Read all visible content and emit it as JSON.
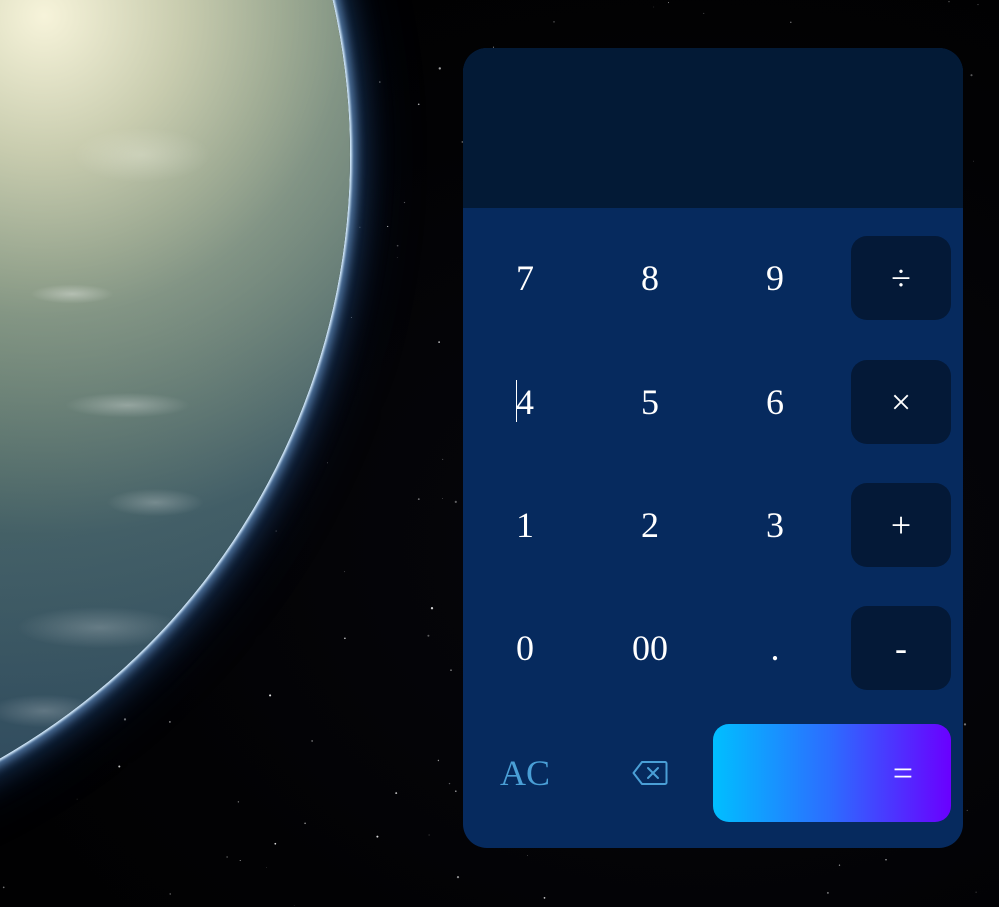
{
  "display": {
    "value": ""
  },
  "keys": {
    "row1": [
      "7",
      "8",
      "9",
      "÷"
    ],
    "row2": [
      "4",
      "5",
      "6",
      "×"
    ],
    "row3": [
      "1",
      "2",
      "3",
      "+"
    ],
    "row4": [
      "0",
      "00",
      ".",
      "-"
    ],
    "ac": "AC",
    "equals": "="
  },
  "colors": {
    "panel": "#062a5e",
    "display": "#031a36",
    "operator_key": "#041937",
    "ac_text": "#4a9fd6",
    "equals_gradient_start": "#00bfff",
    "equals_gradient_end": "#6a00ff"
  },
  "icons": {
    "backspace": "backspace-icon"
  }
}
